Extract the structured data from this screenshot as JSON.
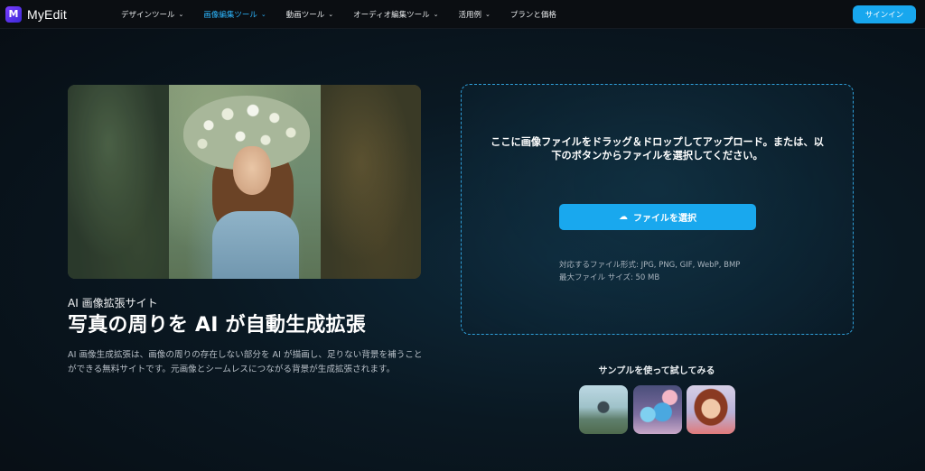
{
  "brand": {
    "name": "MyEdit",
    "logo_glyph": "M"
  },
  "nav": {
    "items": [
      {
        "label": "デザインツール",
        "has_dropdown": true,
        "active": false
      },
      {
        "label": "画像編集ツール",
        "has_dropdown": true,
        "active": true
      },
      {
        "label": "動画ツール",
        "has_dropdown": true,
        "active": false
      },
      {
        "label": "オーディオ編集ツール",
        "has_dropdown": true,
        "active": false
      },
      {
        "label": "活用例",
        "has_dropdown": true,
        "active": false
      },
      {
        "label": "プランと価格",
        "has_dropdown": false,
        "active": false
      }
    ],
    "signin_label": "サインイン"
  },
  "hero": {
    "subtitle": "AI 画像拡張サイト",
    "title": "写真の周りを AI が自動生成拡張",
    "description": "AI 画像生成拡張は、画像の周りの存在しない部分を AI が描画し、足りない背景を補うことができる無料サイトです。元画像とシームレスにつながる背景が生成拡張されます。"
  },
  "upload": {
    "instructions": "ここに画像ファイルをドラッグ＆ドロップしてアップロード。または、以下のボタンからファイルを選択してください。",
    "button_label": "ファイルを選択",
    "button_icon": "cloud-upload-icon",
    "formats_text": "対応するファイル形式: JPG, PNG, GIF, WebP, BMP",
    "max_size_text": "最大ファイル サイズ: 50 MB"
  },
  "samples": {
    "label": "サンプルを使って試してみる"
  },
  "colors": {
    "accent": "#19a8ee",
    "active_nav": "#2db7ff",
    "brand": "#5a32e6",
    "nav_bg": "#0b0e12"
  }
}
